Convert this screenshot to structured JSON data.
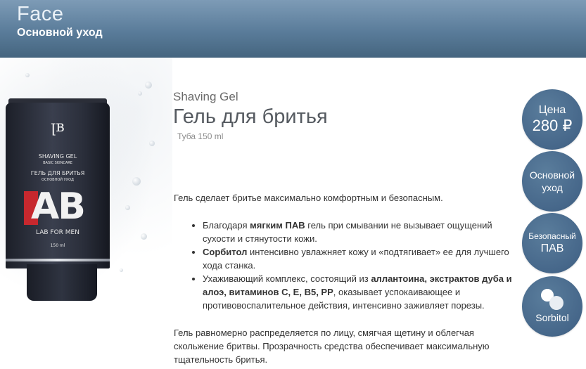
{
  "header": {
    "title": "Face",
    "subtitle": "Основной уход"
  },
  "product": {
    "name_en": "Shaving Gel",
    "name_ru": "Гель для бритья",
    "volume": "Туба 150 ml",
    "tube": {
      "line1": "SHAVING GEL",
      "line2": "BASIC SKINCARE",
      "line3": "ГЕЛЬ ДЛЯ БРИТЬЯ",
      "line4": "ОСНОВНОЙ УХОД",
      "logo": "AB",
      "brand": "LAB FOR MEN",
      "volume": "150 ml"
    }
  },
  "description": {
    "intro": "Гель сделает бритье максимально комфортным и безопасным.",
    "bullets": [
      {
        "pre": "Благодаря ",
        "bold": "мягким ПАВ",
        "post": " гель при смывании не вызывает ощущений сухости и стянутости кожи."
      },
      {
        "pre": "",
        "bold": "Сорбитол",
        "post": " интенсивно увлажняет кожу и «подтягивает» ее для лучшего хода станка."
      },
      {
        "pre": "Ухаживающий комплекс, состоящий из ",
        "bold": "аллантоина, экстрактов дуба и алоэ, витаминов С, Е, В5, РР",
        "post": ", оказывает успокаивающее и противовоспалительное действия, интенсивно заживляет порезы."
      }
    ],
    "outro": "Гель равномерно распределяется по лицу, смягчая щетину и облегчая скольжение бритвы. Прозрачность средства обеспечивает максимальную тщательность бритья."
  },
  "badges": {
    "price_label": "Цена",
    "price_value": "280 ₽",
    "basic_care": "Основной уход",
    "safe_surfactant_line1": "Безопасный",
    "safe_surfactant_line2": "ПАВ",
    "sorbitol": "Sorbitol"
  },
  "colors": {
    "header": "#5a7c9a",
    "badge": "#46678a"
  }
}
